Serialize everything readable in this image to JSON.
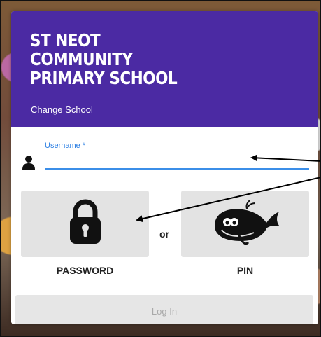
{
  "school": {
    "name": "ST NEOT COMMUNITY PRIMARY SCHOOL",
    "change_school_label": "Change School"
  },
  "login_form": {
    "username_label": "Username *",
    "username_value": "",
    "password_option_label": "PASSWORD",
    "or_label": "or",
    "pin_option_label": "PIN",
    "login_button_label": "Log In"
  },
  "icons": {
    "user": "user-icon",
    "password": "padlock-icon",
    "pin": "whale-icon"
  },
  "colors": {
    "header": "#4b2aa3",
    "accent": "#3b8ee8",
    "tile": "#e3e3e3"
  }
}
